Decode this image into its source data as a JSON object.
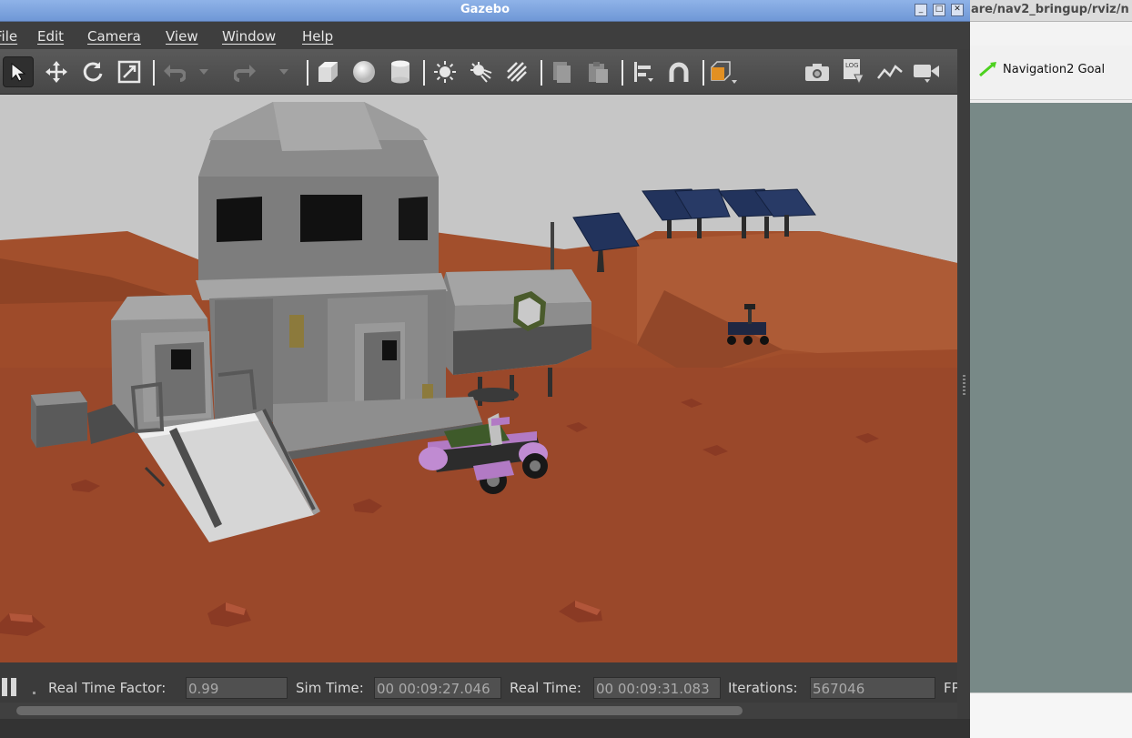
{
  "gazebo": {
    "title": "Gazebo",
    "menu": [
      "File",
      "Edit",
      "Camera",
      "View",
      "Window",
      "Help"
    ],
    "toolbar_icons": [
      "select-arrow",
      "translate",
      "rotate",
      "scale",
      "undo",
      "redo",
      "box",
      "sphere",
      "cylinder",
      "point-light",
      "spot-light",
      "directional-light",
      "copy",
      "paste",
      "align",
      "snap",
      "view-angle",
      "screenshot",
      "log",
      "plot",
      "record-video"
    ],
    "status": {
      "real_time_factor_label": "Real Time Factor:",
      "real_time_factor": "0.99",
      "sim_time_label": "Sim Time:",
      "sim_time": "00 00:09:27.046",
      "real_time_label": "Real Time:",
      "real_time": "00 00:09:31.083",
      "iterations_label": "Iterations:",
      "iterations": "567046",
      "fps_label": "FPS"
    },
    "colors": {
      "sky": "#c6c6c6",
      "ground": "#9e4b2a",
      "toolbar": "#505050",
      "accent_orange": "#e39022",
      "rover_purple": "#b27ac4"
    }
  },
  "rviz": {
    "title": "are/nav2_bringup/rviz/n",
    "goal_button": "Navigation2 Goal",
    "colors": {
      "viewport": "#788987"
    }
  }
}
